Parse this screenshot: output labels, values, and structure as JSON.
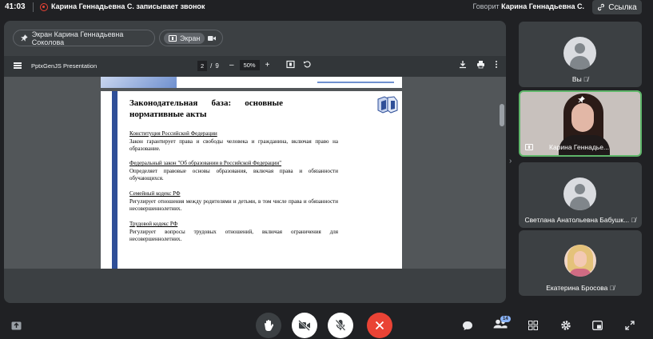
{
  "topbar": {
    "time": "41:03",
    "recording_text": "Карина Геннадьевна С. записывает звонок",
    "speaking_prefix": "Говорит",
    "speaking_name": "Карина Геннадьевна С.",
    "link_label": "Ссылка"
  },
  "share": {
    "presenter_pill": "Экран Карина Геннадьевна Соколова",
    "screen_pill": "Экран"
  },
  "pdf": {
    "title": "PptxGenJS Presentation",
    "page_current": "2",
    "page_sep": "/",
    "page_total": "9",
    "zoom": "50%"
  },
  "slide": {
    "title": "Законодательная база: основные нормативные акты",
    "blocks": [
      {
        "heading": "Конституция Российской Федерации",
        "text": "Закон гарантирует права и свободы человека и гражданина, включая право на образование."
      },
      {
        "heading": "Федеральный закон \"Об образовании в Российской Федерации\"",
        "text": "Определяет правовые основы образования, включая права и обязанности обучающихся."
      },
      {
        "heading": "Семейный кодекс РФ",
        "text": "Регулирует отношения между родителями и детьми, в том числе права и обязанности несовершеннолетних."
      },
      {
        "heading": "Трудовой кодекс РФ",
        "text": "Регулирует вопросы трудовых отношений, включая ограничения для несовершеннолетних."
      }
    ]
  },
  "participants": [
    {
      "name": "Вы"
    },
    {
      "name": "Карина Геннадье..."
    },
    {
      "name": "Светлана Анатольевна Бабушк..."
    },
    {
      "name": "Екатерина Бросова"
    }
  ],
  "bottombar": {
    "people_count": "14"
  },
  "colors": {
    "background": "#202124",
    "panel": "#3c4043",
    "active_speaker": "#5fb66a",
    "end_call": "#ea4335",
    "slide_bar": "#2f4f98"
  }
}
